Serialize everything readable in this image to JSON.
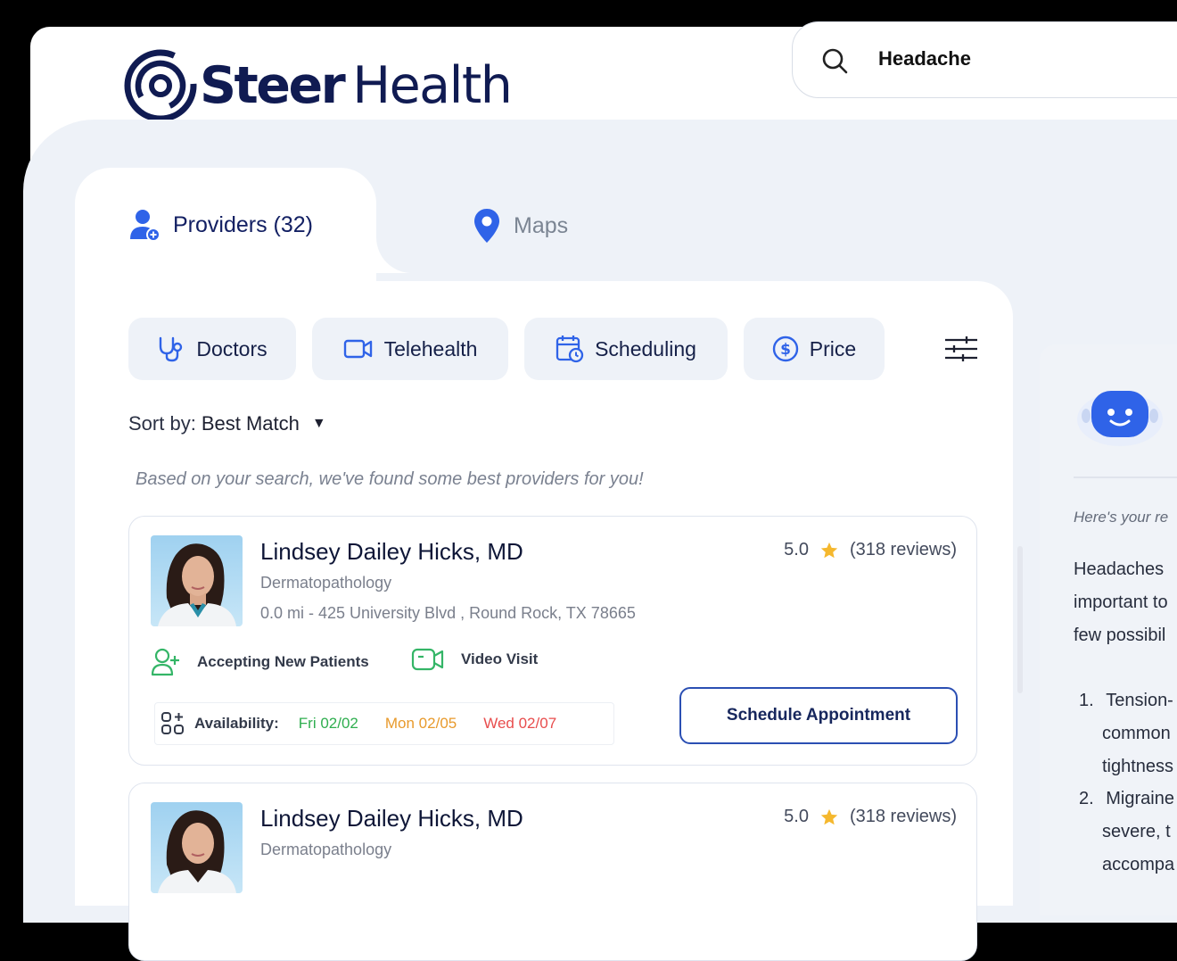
{
  "brand": {
    "name_bold": "Steer",
    "name_light": "Health"
  },
  "search": {
    "value": "Headache"
  },
  "tabs": [
    {
      "label": "Providers (32)",
      "icon": "user-plus-icon",
      "active": true
    },
    {
      "label": "Maps",
      "icon": "map-pin-icon",
      "active": false
    }
  ],
  "filters": [
    {
      "label": "Doctors",
      "icon": "stethoscope-icon"
    },
    {
      "label": "Telehealth",
      "icon": "video-camera-icon"
    },
    {
      "label": "Scheduling",
      "icon": "calendar-clock-icon"
    },
    {
      "label": "Price",
      "icon": "dollar-circle-icon"
    }
  ],
  "sort": {
    "prefix": "Sort by:",
    "value": "Best Match"
  },
  "note": "Based on your search, we've found some best providers for you!",
  "providers": [
    {
      "name": "Lindsey Dailey Hicks, MD",
      "specialty": "Dermatopathology",
      "address": "0.0 mi - 425 University Blvd , Round Rock, TX 78665",
      "rating": "5.0",
      "reviews": "(318 reviews)",
      "features": [
        "Accepting New Patients",
        "Video Visit"
      ],
      "availability_label": "Availability:",
      "availability": [
        "Fri 02/02",
        "Mon 02/05",
        "Wed 02/07"
      ],
      "cta": "Schedule Appointment"
    },
    {
      "name": "Lindsey Dailey Hicks, MD",
      "specialty": "Dermatopathology",
      "rating": "5.0",
      "reviews": "(318 reviews)"
    }
  ],
  "colors": {
    "accent": "#2b4fb3",
    "available_soon": "#2fae4f",
    "available_mid": "#e89a2c",
    "available_late": "#e84d4d",
    "star": "#f5b82e"
  },
  "chat": {
    "intro": "Here's your re",
    "lines": [
      "Headaches",
      "important to",
      "few possibil"
    ],
    "list": [
      {
        "num": "1.",
        "head": "Tension-",
        "cont": [
          "common",
          "tightness"
        ]
      },
      {
        "num": "2.",
        "head": "Migraine",
        "cont": [
          "severe, t",
          "accompa"
        ]
      }
    ]
  }
}
